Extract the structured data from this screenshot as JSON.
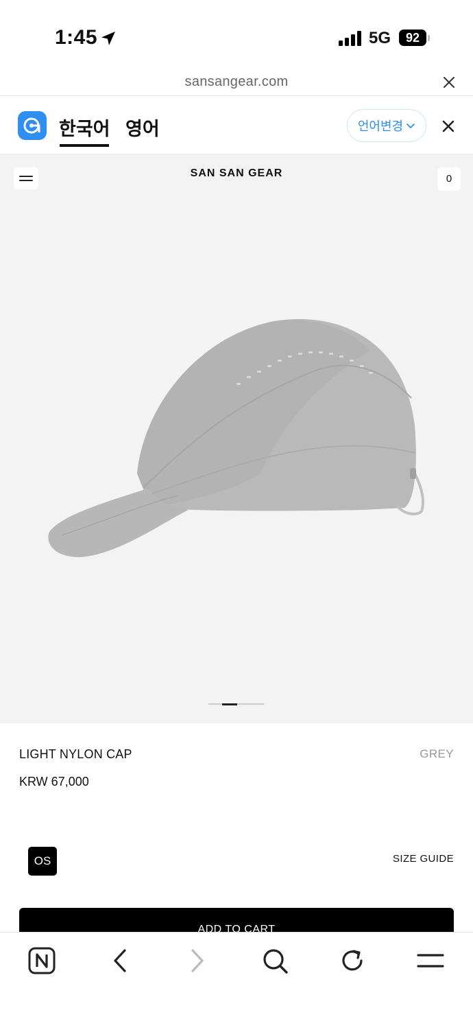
{
  "status_bar": {
    "time": "1:45",
    "network": "5G",
    "battery": "92"
  },
  "browser": {
    "url": "sansangear.com"
  },
  "translate_bar": {
    "languages": [
      "한국어",
      "영어"
    ],
    "selected_language": "한국어",
    "change_language_label": "언어변경",
    "accent_color": "#2e8ff0"
  },
  "site_header": {
    "brand": "SAN SAN GEAR",
    "cart_count": "0"
  },
  "product": {
    "name": "LIGHT NYLON CAP",
    "color": "GREY",
    "price": "KRW 67,000",
    "sizes": [
      "OS"
    ],
    "selected_size": "OS",
    "size_guide_label": "SIZE GUIDE",
    "add_to_cart_label": "ADD TO CART",
    "image_count": 3,
    "active_image_index": 1
  },
  "bottom_toolbar": {
    "icons": [
      "naver-home-icon",
      "back-icon",
      "forward-icon",
      "search-icon",
      "reload-icon",
      "menu-icon"
    ]
  }
}
